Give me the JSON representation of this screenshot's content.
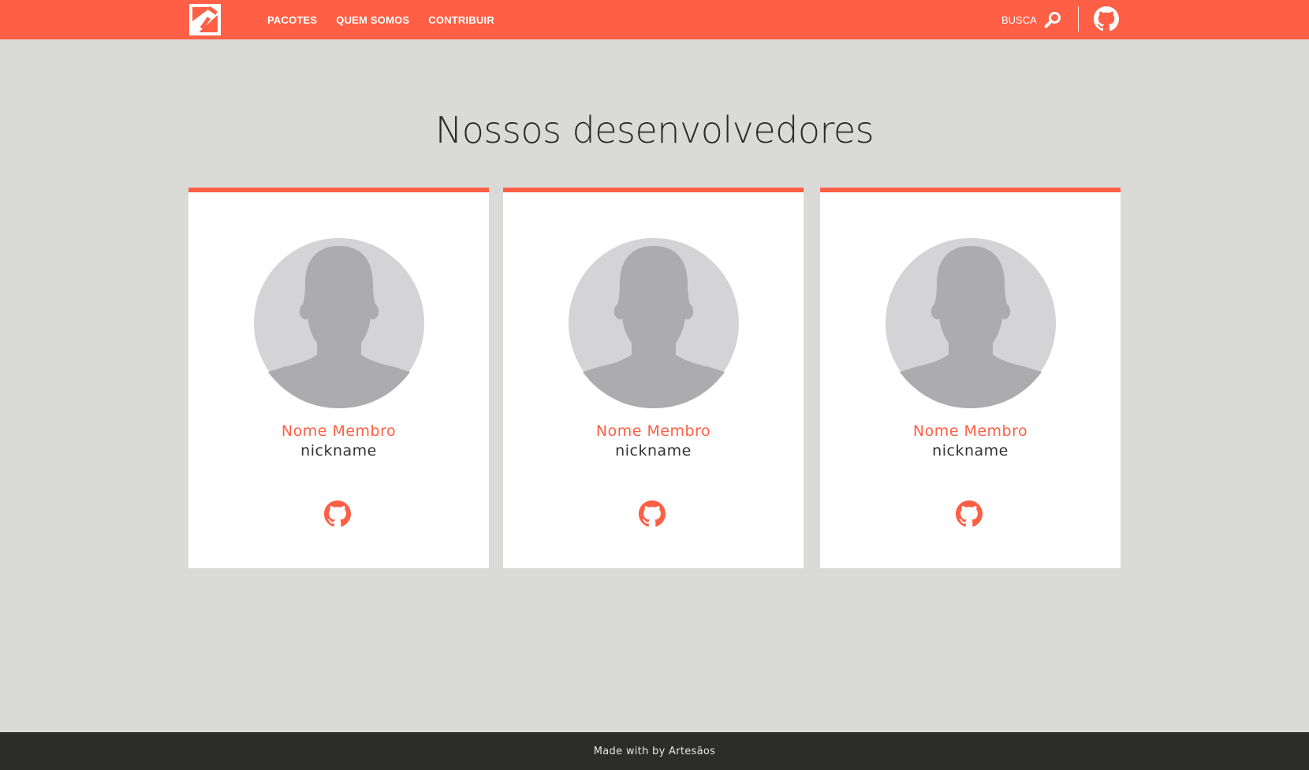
{
  "nav": {
    "links": [
      "PACOTES",
      "QUEM SOMOS",
      "CONTRIBUIR"
    ],
    "search_label": "BUSCA",
    "icons": {
      "logo": "brand-logo",
      "search": "search-icon",
      "github": "github-icon"
    }
  },
  "colors": {
    "accent": "#fe5f45",
    "background": "#dadbd9",
    "footer": "#2c2c28",
    "card": "#ffffff"
  },
  "page": {
    "title": "Nossos desenvolvedores"
  },
  "members": [
    {
      "name": "Nome Membro",
      "nickname": "nickname",
      "avatar_icon": "avatar-placeholder-icon",
      "link_icon": "github-icon"
    },
    {
      "name": "Nome Membro",
      "nickname": "nickname",
      "avatar_icon": "avatar-placeholder-icon",
      "link_icon": "github-icon"
    },
    {
      "name": "Nome Membro",
      "nickname": "nickname",
      "avatar_icon": "avatar-placeholder-icon",
      "link_icon": "github-icon"
    }
  ],
  "footer": {
    "text": "Made with by Artesãos"
  }
}
